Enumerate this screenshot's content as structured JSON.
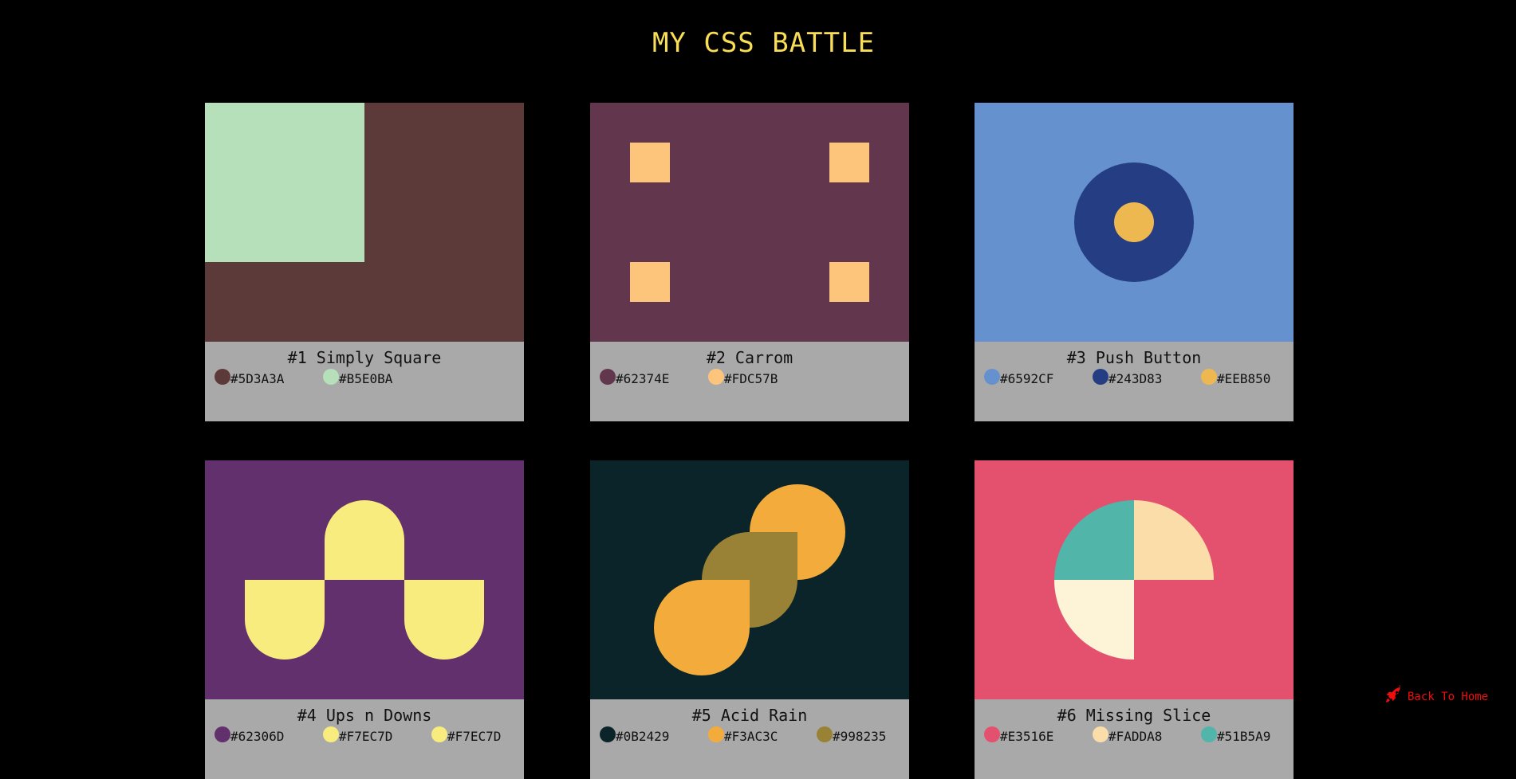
{
  "page": {
    "title": "MY CSS BATTLE"
  },
  "cards": [
    {
      "label": "#1 Simply Square",
      "colors": [
        "#5D3A3A",
        "#B5E0BA"
      ]
    },
    {
      "label": "#2 Carrom",
      "colors": [
        "#62374E",
        "#FDC57B"
      ]
    },
    {
      "label": "#3 Push Button",
      "colors": [
        "#6592CF",
        "#243D83",
        "#EEB850"
      ]
    },
    {
      "label": "#4 Ups n Downs",
      "colors": [
        "#62306D",
        "#F7EC7D",
        "#F7EC7D"
      ]
    },
    {
      "label": "#5 Acid Rain",
      "colors": [
        "#0B2429",
        "#F3AC3C",
        "#998235"
      ]
    },
    {
      "label": "#6 Missing Slice",
      "colors": [
        "#E3516E",
        "#FADDA8",
        "#51B5A9"
      ]
    }
  ],
  "footer": {
    "back_label": "Back To Home",
    "icon": "rocket-icon"
  }
}
